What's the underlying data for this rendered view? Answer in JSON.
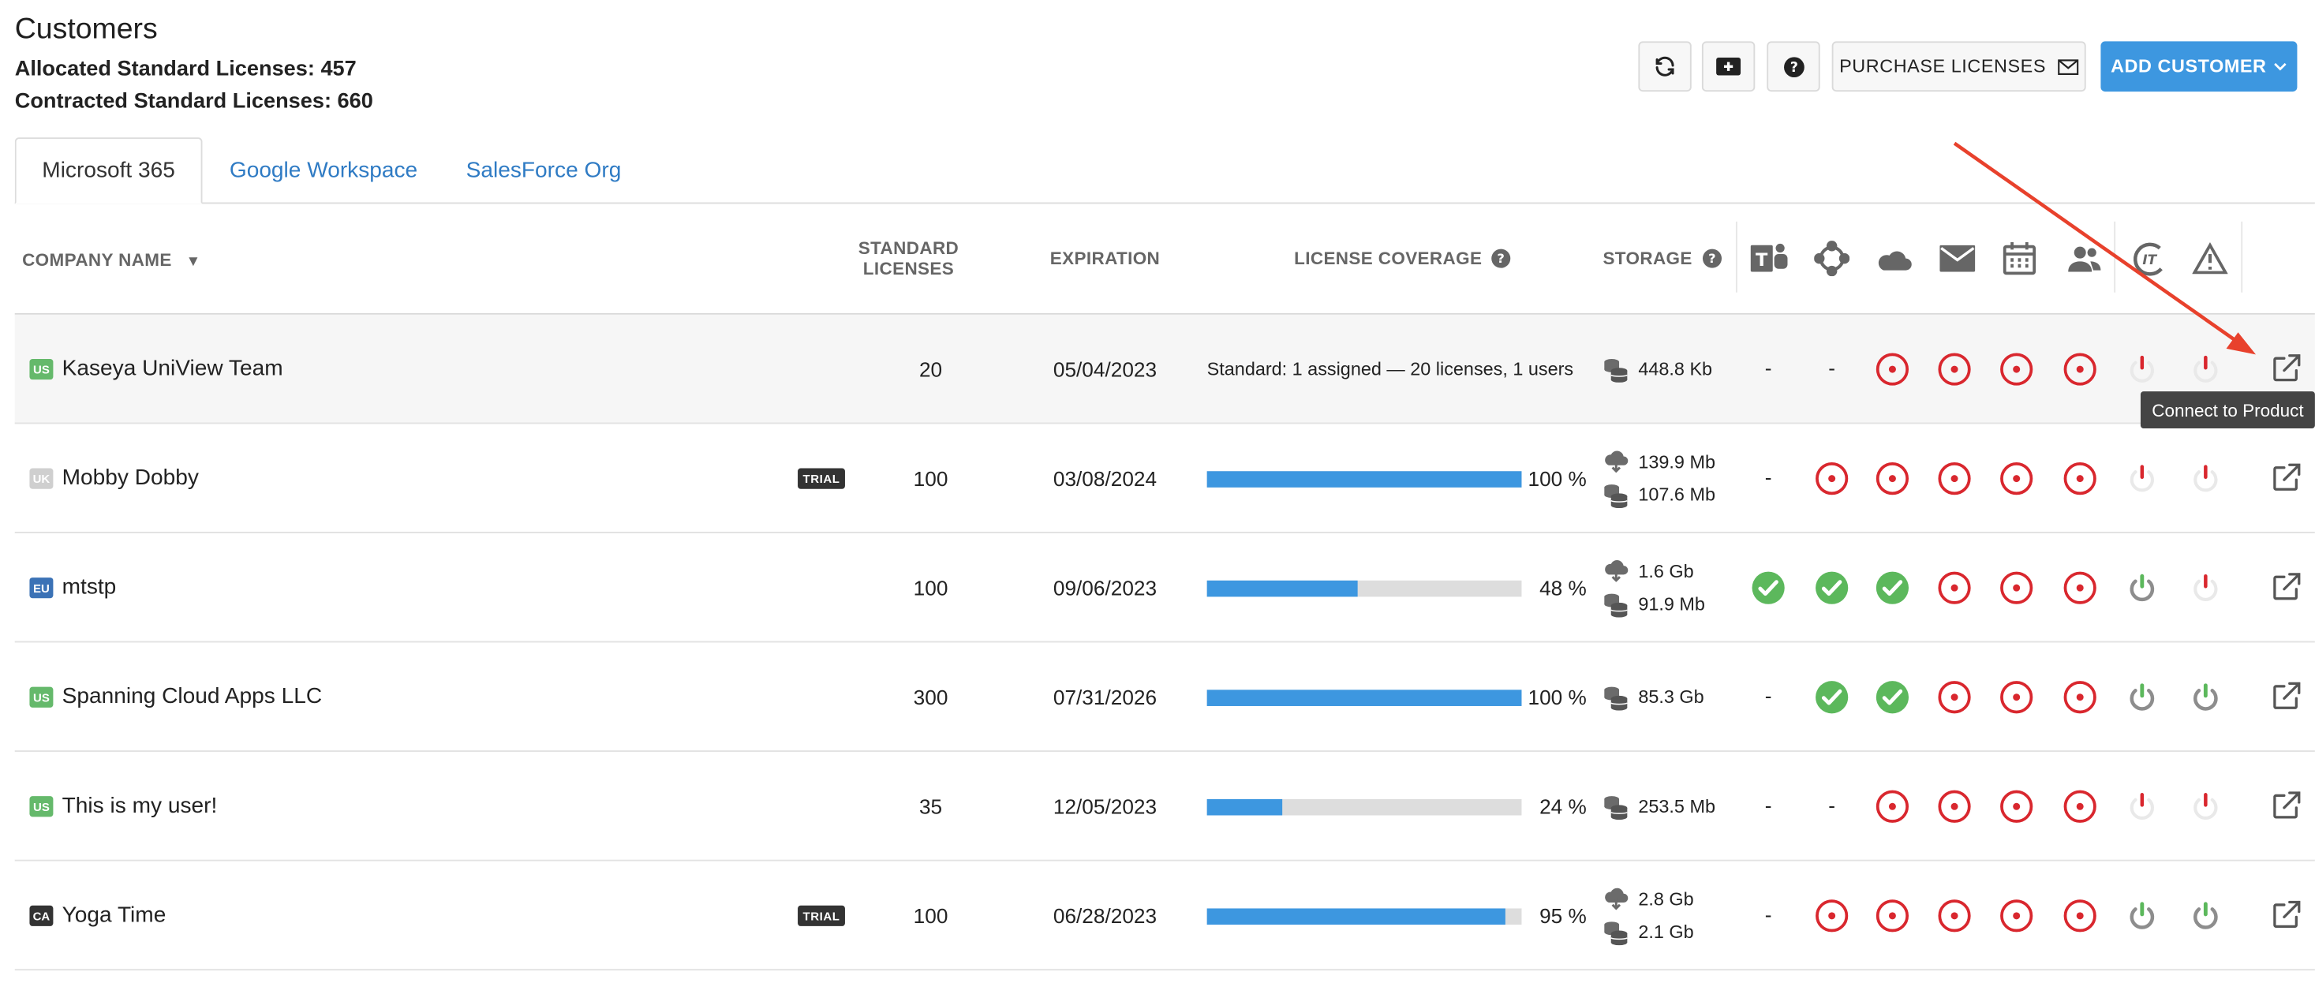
{
  "page": {
    "title": "Customers",
    "allocated": "Allocated Standard Licenses: 457",
    "contracted": "Contracted Standard Licenses: 660"
  },
  "toolbar": {
    "refresh_icon": "refresh-icon",
    "add_icon": "add-box-icon",
    "help_icon": "help-icon",
    "purchase_label": "PURCHASE LICENSES",
    "add_customer_label": "ADD CUSTOMER"
  },
  "tabs": [
    {
      "label": "Microsoft 365",
      "active": true
    },
    {
      "label": "Google Workspace",
      "active": false
    },
    {
      "label": "SalesForce Org",
      "active": false
    }
  ],
  "table": {
    "headers": {
      "company": "COMPANY NAME",
      "sort_mark": "▼",
      "licenses_1": "STANDARD",
      "licenses_2": "LICENSES",
      "expiration": "EXPIRATION",
      "coverage": "LICENSE COVERAGE",
      "storage": "STORAGE"
    },
    "service_icons": [
      "teams-icon",
      "sharepoint-icon",
      "onedrive-icon",
      "mail-icon",
      "calendar-icon",
      "contacts-icon",
      "it-complete-icon",
      "alert-triangle-icon"
    ],
    "rows": [
      {
        "region": "US",
        "name": "Kaseya UniView Team",
        "trial": false,
        "licenses": "20",
        "expiration": "05/04/2023",
        "coverage_text": "Standard: 1 assigned — 20 licenses, 1 users",
        "storage": [
          {
            "icon": "database-icon",
            "value": "448.8 Kb"
          }
        ],
        "statuses": [
          "dash",
          "dash",
          "target",
          "target",
          "target",
          "target",
          "power-red",
          "power-red"
        ]
      },
      {
        "region": "UK",
        "name": "Mobby Dobby",
        "trial": true,
        "licenses": "100",
        "expiration": "03/08/2024",
        "coverage_percent": 100,
        "coverage_label": "100 %",
        "storage": [
          {
            "icon": "cloud-icon",
            "value": "139.9 Mb"
          },
          {
            "icon": "database-icon",
            "value": "107.6 Mb"
          }
        ],
        "statuses": [
          "dash",
          "target",
          "target",
          "target",
          "target",
          "target",
          "power-red",
          "power-red"
        ]
      },
      {
        "region": "EU",
        "name": "mtstp",
        "trial": false,
        "licenses": "100",
        "expiration": "09/06/2023",
        "coverage_percent": 48,
        "coverage_label": "48 %",
        "storage": [
          {
            "icon": "cloud-icon",
            "value": "1.6 Gb"
          },
          {
            "icon": "database-icon",
            "value": "91.9 Mb"
          }
        ],
        "statuses": [
          "check",
          "check",
          "check",
          "target",
          "target",
          "target",
          "power-green",
          "power-red"
        ]
      },
      {
        "region": "US",
        "name": "Spanning Cloud Apps LLC",
        "trial": false,
        "licenses": "300",
        "expiration": "07/31/2026",
        "coverage_percent": 100,
        "coverage_label": "100 %",
        "storage": [
          {
            "icon": "database-icon",
            "value": "85.3 Gb"
          }
        ],
        "statuses": [
          "dash",
          "check",
          "check",
          "target",
          "target",
          "target",
          "power-green",
          "power-green"
        ]
      },
      {
        "region": "US",
        "name": "This is my user!",
        "trial": false,
        "licenses": "35",
        "expiration": "12/05/2023",
        "coverage_percent": 24,
        "coverage_label": "24 %",
        "storage": [
          {
            "icon": "database-icon",
            "value": "253.5 Mb"
          }
        ],
        "statuses": [
          "dash",
          "dash",
          "target",
          "target",
          "target",
          "target",
          "power-red",
          "power-red"
        ]
      },
      {
        "region": "CA",
        "name": "Yoga Time",
        "trial": true,
        "licenses": "100",
        "expiration": "06/28/2023",
        "coverage_percent": 95,
        "coverage_label": "95 %",
        "storage": [
          {
            "icon": "cloud-icon",
            "value": "2.8 Gb"
          },
          {
            "icon": "database-icon",
            "value": "2.1 Gb"
          }
        ],
        "statuses": [
          "dash",
          "target",
          "target",
          "target",
          "target",
          "target",
          "power-green",
          "power-green"
        ]
      }
    ],
    "trial_label": "TRIAL",
    "dash": "-"
  },
  "tooltip": "Connect to Product",
  "colors": {
    "accent": "#3d97e0",
    "link": "#2f7bc4",
    "error": "#d9272e",
    "success": "#5cb85c",
    "annotation": "#e8412c"
  }
}
